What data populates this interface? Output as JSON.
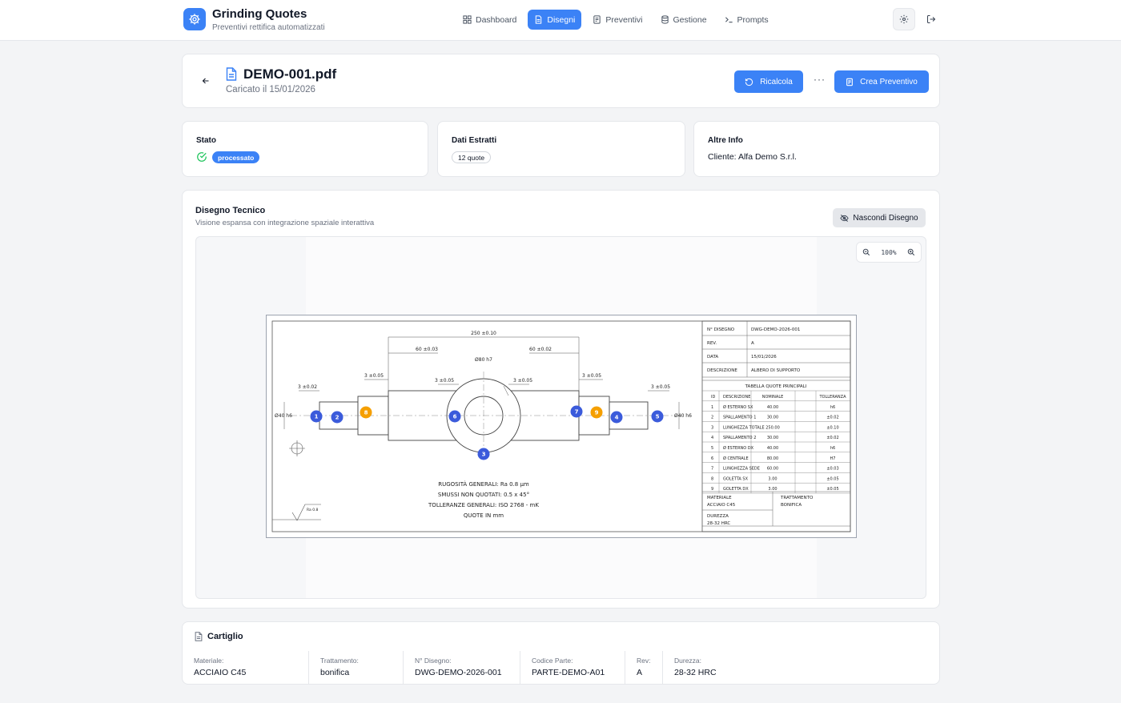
{
  "app": {
    "title": "Grinding Quotes",
    "subtitle": "Preventivi rettifica automatizzati"
  },
  "nav": [
    {
      "label": "Dashboard",
      "icon": "grid-icon",
      "active": false
    },
    {
      "label": "Disegni",
      "icon": "file-icon",
      "active": true
    },
    {
      "label": "Preventivi",
      "icon": "document-icon",
      "active": false
    },
    {
      "label": "Gestione",
      "icon": "database-icon",
      "active": false
    },
    {
      "label": "Prompts",
      "icon": "terminal-icon",
      "active": false
    }
  ],
  "header": {
    "file_name": "DEMO-001.pdf",
    "uploaded": "Caricato il 15/01/2026",
    "recalc_label": "Ricalcola",
    "more_label": "···",
    "create_quote_label": "Crea Preventivo"
  },
  "status": {
    "label": "Stato",
    "value": "processato"
  },
  "extracted": {
    "label": "Dati Estratti",
    "value": "12 quote"
  },
  "other": {
    "label": "Altre Info",
    "value": "Cliente: Alfa Demo S.r.l."
  },
  "drawing_panel": {
    "title": "Disegno Tecnico",
    "subtitle": "Visione espansa con integrazione spaziale interattiva",
    "hide_label": "Nascondi Disegno",
    "zoom": "100%"
  },
  "drawing": {
    "dims": {
      "total": "250 ±0.10",
      "left_shoulder": "60 ±0.03",
      "right_shoulder": "60 ±0.02",
      "center_dia_a": "Ø80 h7",
      "left_collar": "3 ±0.05",
      "right_collar": "3 ±0.05",
      "left_inner": "3 ±0.05",
      "right_inner": "3 ±0.05",
      "left_end": "3 ±0.02",
      "right_end": "3 ±0.05",
      "left_dia": "Ø40 h6",
      "right_dia": "Ø40 h6",
      "roughness_symbol": "Ra 0.8"
    },
    "notes": [
      "RUGOSITÀ GENERALI: Ra 0.8 µm",
      "SMUSSI NON QUOTATI: 0.5 x 45°",
      "TOLLERANZE GENERALI: ISO 2768 - mK",
      "QUOTE IN mm"
    ],
    "title_block": [
      {
        "k": "N° DISEGNO",
        "v": "DWG-DEMO-2026-001"
      },
      {
        "k": "REV.",
        "v": "A"
      },
      {
        "k": "DATA",
        "v": "15/01/2026"
      },
      {
        "k": "DESCRIZIONE",
        "v": "ALBERO DI SUPPORTO"
      }
    ],
    "table_title": "TABELLA QUOTE PRINCIPALI",
    "table_headers": [
      "ID",
      "DESCRIZIONE",
      "NOMINALE",
      "TOLLERANZA"
    ],
    "table_rows": [
      [
        "1",
        "Ø ESTERNO SX",
        "40.00",
        "h6"
      ],
      [
        "2",
        "SPALLAMENTO 1",
        "30.00",
        "±0.02"
      ],
      [
        "3",
        "LUNGHEZZA TOTALE",
        "250.00",
        "±0.10"
      ],
      [
        "4",
        "SPALLAMENTO 2",
        "30.00",
        "±0.02"
      ],
      [
        "5",
        "Ø ESTERNO DX",
        "40.00",
        "h6"
      ],
      [
        "6",
        "Ø CENTRALE",
        "80.00",
        "H7"
      ],
      [
        "7",
        "LUNGHEZZA SEDE",
        "60.00",
        "±0.03"
      ],
      [
        "8",
        "GOLETTA SX",
        "3.00",
        "±0.05"
      ],
      [
        "9",
        "GOLETTA DX",
        "3.00",
        "±0.05"
      ]
    ],
    "material_k": "MATERIALE",
    "material_v": "ACCIAIO C45",
    "treatment_k": "TRATTAMENTO",
    "treatment_v": "BONIFICA",
    "hardness_k": "DUREZZA",
    "hardness_v": "28-32 HRC",
    "markers": [
      {
        "id": "1",
        "color": "#3b5bdb"
      },
      {
        "id": "2",
        "color": "#3b5bdb"
      },
      {
        "id": "8",
        "color": "#f59f00"
      },
      {
        "id": "6",
        "color": "#3b5bdb"
      },
      {
        "id": "3",
        "color": "#3b5bdb"
      },
      {
        "id": "7",
        "color": "#3b5bdb"
      },
      {
        "id": "9",
        "color": "#f59f00"
      },
      {
        "id": "4",
        "color": "#3b5bdb"
      },
      {
        "id": "5",
        "color": "#3b5bdb"
      }
    ]
  },
  "cartiglio": {
    "title": "Cartiglio",
    "fields": [
      {
        "k": "Materiale:",
        "v": "ACCIAIO C45"
      },
      {
        "k": "Trattamento:",
        "v": "bonifica"
      },
      {
        "k": "N° Disegno:",
        "v": "DWG-DEMO-2026-001"
      },
      {
        "k": "Codice Parte:",
        "v": "PARTE-DEMO-A01"
      },
      {
        "k": "Rev:",
        "v": "A"
      },
      {
        "k": "Durezza:",
        "v": "28-32 HRC"
      }
    ]
  },
  "colors": {
    "accent": "#3b82f6",
    "marker_blue": "#3b5bdb",
    "marker_orange": "#f59f00",
    "success": "#22c55e"
  }
}
